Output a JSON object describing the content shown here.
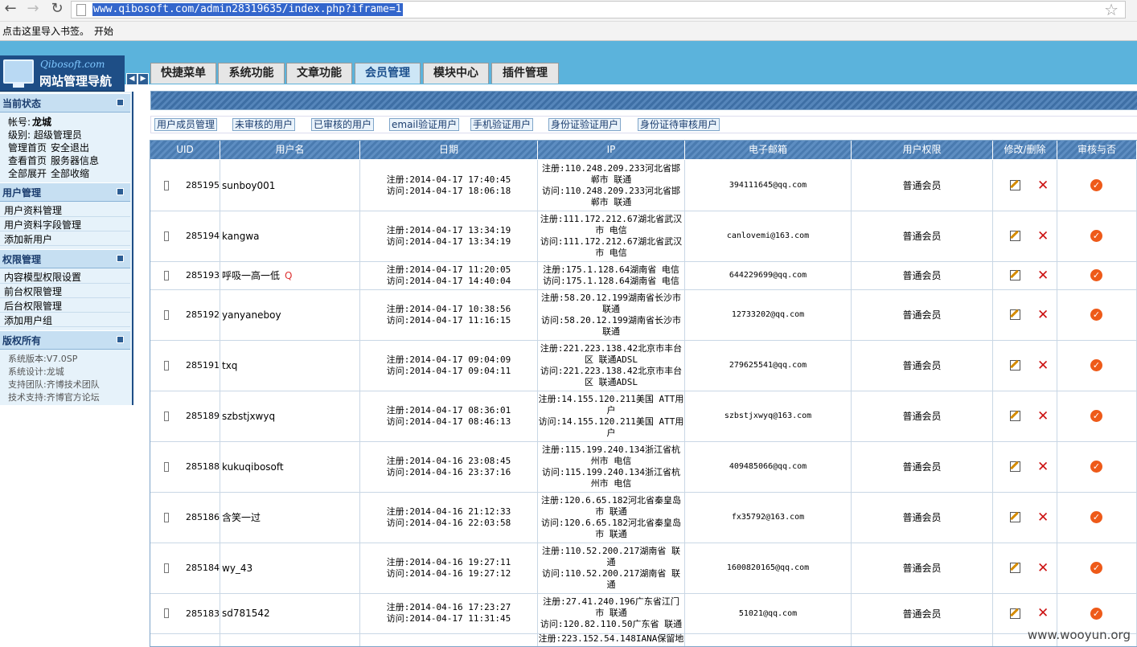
{
  "browser": {
    "url": "www.qibosoft.com/admin28319635/index.php?iframe=1",
    "bookmark_hint": "点击这里导入书签。",
    "bookmark_start": "开始"
  },
  "logo": {
    "en": "Qibosoft.com",
    "cn": "网站管理导航"
  },
  "tabs": [
    "快捷菜单",
    "系统功能",
    "文章功能",
    "会员管理",
    "模块中心",
    "插件管理"
  ],
  "active_tab": "会员管理",
  "sidebar": {
    "status": {
      "title": "当前状态",
      "account_label": "帐号:",
      "account_name": "龙城",
      "level": "级别: 超级管理员",
      "links": [
        "管理首页",
        "安全退出",
        "查看首页",
        "服务器信息",
        "全部展开",
        "全部收缩"
      ]
    },
    "user_mgmt": {
      "title": "用户管理",
      "items": [
        "用户资料管理",
        "用户资料字段管理",
        "添加新用户"
      ]
    },
    "perm_mgmt": {
      "title": "权限管理",
      "items": [
        "内容模型权限设置",
        "前台权限管理",
        "后台权限管理",
        "添加用户组"
      ]
    },
    "copyright": {
      "title": "版权所有",
      "items": [
        "系统版本:V7.0SP",
        "系统设计:龙城",
        "支持团队:齐博技术团队",
        "技术支持:齐博官方论坛"
      ]
    }
  },
  "subnav": [
    "用户成员管理",
    "未审核的用户",
    "已审核的用户",
    "email验证用户",
    "手机验证用户",
    "身份证验证用户",
    "身份证待审核用户"
  ],
  "table": {
    "headers": [
      "UID",
      "用户名",
      "日期",
      "IP",
      "电子邮箱",
      "用户权限",
      "修改/删除",
      "审核与否"
    ],
    "rows": [
      {
        "uid": "285195",
        "name": "sunboy001",
        "reg": "注册:2014-04-17 17:40:45",
        "visit": "访问:2014-04-17 18:06:18",
        "ip": [
          "注册:110.248.209.233河北省邯",
          "郸市 联通",
          "访问:110.248.209.233河北省邯",
          "郸市 联通"
        ],
        "email": "394111645@qq.com",
        "perm": "普通会员"
      },
      {
        "uid": "285194",
        "name": "kangwa",
        "reg": "注册:2014-04-17 13:34:19",
        "visit": "访问:2014-04-17 13:34:19",
        "ip": [
          "注册:111.172.212.67湖北省武汉",
          "市 电信",
          "访问:111.172.212.67湖北省武汉",
          "市 电信"
        ],
        "email": "canlovemi@163.com",
        "perm": "普通会员"
      },
      {
        "uid": "285193",
        "name": "呼吸一高一低",
        "q": "Q",
        "reg": "注册:2014-04-17 11:20:05",
        "visit": "访问:2014-04-17 14:40:04",
        "ip": [
          "注册:175.1.128.64湖南省 电信",
          "访问:175.1.128.64湖南省 电信"
        ],
        "email": "644229699@qq.com",
        "perm": "普通会员"
      },
      {
        "uid": "285192",
        "name": "yanyaneboy",
        "reg": "注册:2014-04-17 10:38:56",
        "visit": "访问:2014-04-17 11:16:15",
        "ip": [
          "注册:58.20.12.199湖南省长沙市",
          "联通",
          "访问:58.20.12.199湖南省长沙市",
          "联通"
        ],
        "email": "12733202@qq.com",
        "perm": "普通会员"
      },
      {
        "uid": "285191",
        "name": "txq",
        "reg": "注册:2014-04-17 09:04:09",
        "visit": "访问:2014-04-17 09:04:11",
        "ip": [
          "注册:221.223.138.42北京市丰台",
          "区 联通ADSL",
          "访问:221.223.138.42北京市丰台",
          "区 联通ADSL"
        ],
        "email": "279625541@qq.com",
        "perm": "普通会员"
      },
      {
        "uid": "285189",
        "name": "szbstjxwyq",
        "reg": "注册:2014-04-17 08:36:01",
        "visit": "访问:2014-04-17 08:46:13",
        "ip": [
          "注册:14.155.120.211美国 ATT用",
          "户",
          "访问:14.155.120.211美国 ATT用",
          "户"
        ],
        "email": "szbstjxwyq@163.com",
        "perm": "普通会员"
      },
      {
        "uid": "285188",
        "name": "kukuqibosoft",
        "reg": "注册:2014-04-16 23:08:45",
        "visit": "访问:2014-04-16 23:37:16",
        "ip": [
          "注册:115.199.240.134浙江省杭",
          "州市 电信",
          "访问:115.199.240.134浙江省杭",
          "州市 电信"
        ],
        "email": "409485066@qq.com",
        "perm": "普通会员"
      },
      {
        "uid": "285186",
        "name": "含笑一过",
        "reg": "注册:2014-04-16 21:12:33",
        "visit": "访问:2014-04-16 22:03:58",
        "ip": [
          "注册:120.6.65.182河北省秦皇岛",
          "市 联通",
          "访问:120.6.65.182河北省秦皇岛",
          "市 联通"
        ],
        "email": "fx35792@163.com",
        "perm": "普通会员"
      },
      {
        "uid": "285184",
        "name": "wy_43",
        "reg": "注册:2014-04-16 19:27:11",
        "visit": "访问:2014-04-16 19:27:12",
        "ip": [
          "注册:110.52.200.217湖南省 联",
          "通",
          "访问:110.52.200.217湖南省 联",
          "通"
        ],
        "email": "1600820165@qq.com",
        "perm": "普通会员"
      },
      {
        "uid": "285183",
        "name": "sd781542",
        "reg": "注册:2014-04-16 17:23:27",
        "visit": "访问:2014-04-17 11:31:45",
        "ip": [
          "注册:27.41.240.196广东省江门",
          "市 联通",
          "访问:120.82.110.50广东省 联通"
        ],
        "email": "51021@qq.com",
        "perm": "普通会员"
      },
      {
        "uid": "",
        "name": "",
        "reg": "",
        "visit": "",
        "ip": [
          "注册:223.152.54.148IANA保留地"
        ],
        "email": "",
        "perm": ""
      }
    ]
  },
  "watermark": "www.wooyun.org"
}
